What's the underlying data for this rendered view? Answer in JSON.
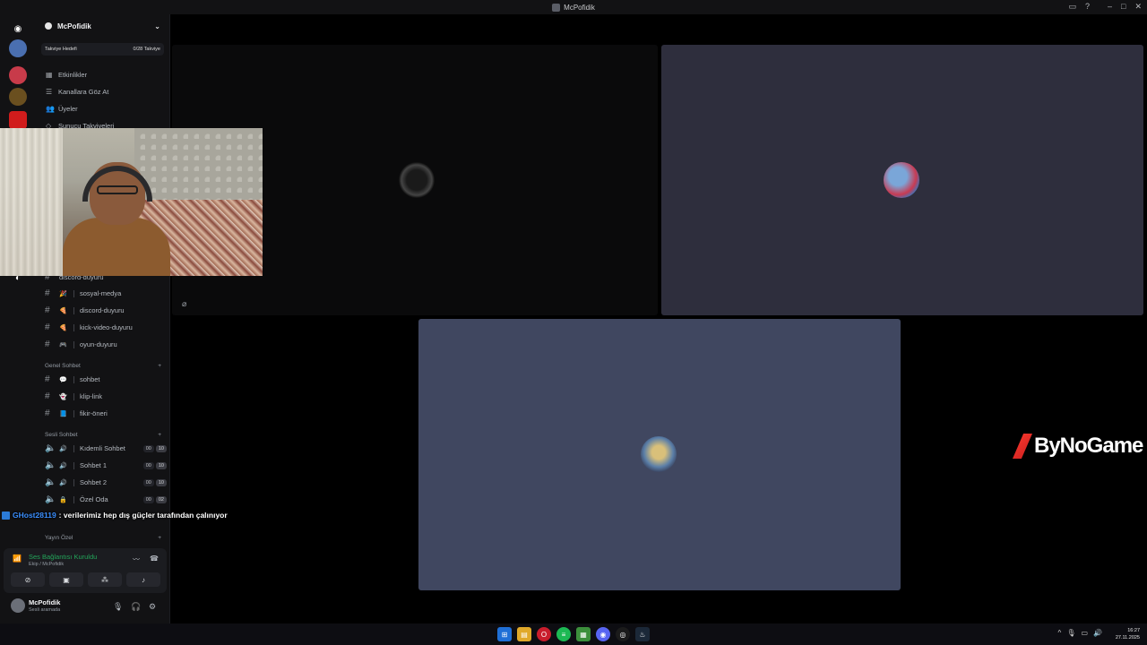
{
  "window": {
    "title": "McPofidik"
  },
  "server": {
    "name": "McPofidik",
    "boost_label": "Takviye Hedefi",
    "boost_count": "0/28 Takviye",
    "menu": [
      {
        "icon": "calendar-icon",
        "label": "Etkinlikler"
      },
      {
        "icon": "browse-icon",
        "label": "Kanallara Göz At"
      },
      {
        "icon": "members-icon",
        "label": "Üyeler"
      }
    ],
    "hidden_menu_partial": "Sunucu Takviyeleri"
  },
  "channels_top": [
    {
      "label": "discord-duyuru",
      "emoji": ""
    },
    {
      "label": "sosyal-medya",
      "emoji": "🎉"
    },
    {
      "label": "discord-duyuru",
      "emoji": "🍕"
    },
    {
      "label": "kick-video-duyuru",
      "emoji": "🍕"
    },
    {
      "label": "oyun-duyuru",
      "emoji": "🎮"
    }
  ],
  "categories": {
    "genel": "Genel Sohbet",
    "sesli": "Sesli Sohbet",
    "yayin": "Yayın Özel"
  },
  "channels_genel": [
    {
      "label": "sohbet",
      "emoji": "💬"
    },
    {
      "label": "klip-link",
      "emoji": "👻"
    },
    {
      "label": "fikir-öneri",
      "emoji": "📘"
    }
  ],
  "voice_channels": [
    {
      "label": "Kıdemli Sohbet",
      "emoji": "🔊",
      "a": "00",
      "b": "10"
    },
    {
      "label": "Sohbet 1",
      "emoji": "🔊",
      "a": "00",
      "b": "10"
    },
    {
      "label": "Sohbet 2",
      "emoji": "🔊",
      "a": "00",
      "b": "10"
    },
    {
      "label": "Özel Oda",
      "emoji": "🔒",
      "a": "00",
      "b": "02"
    }
  ],
  "voice_panel": {
    "status": "Ses Bağlantısı Kuruldu",
    "location": "Ekip / McPofidik"
  },
  "user": {
    "name": "McPofidik",
    "status": "Sesli aramada"
  },
  "chat": {
    "user": "GHost28119",
    "message": ": verilerimiz hep dış güçler tarafından çalınıyor"
  },
  "sponsor": "ByNoGame",
  "clock": {
    "time": "16:27",
    "date": "27.11.2025"
  },
  "colors": {
    "accent_green": "#23a55a",
    "tile_dark": "#2e2e3d",
    "tile_slate": "#404760",
    "brand_red": "#e52b2b"
  }
}
